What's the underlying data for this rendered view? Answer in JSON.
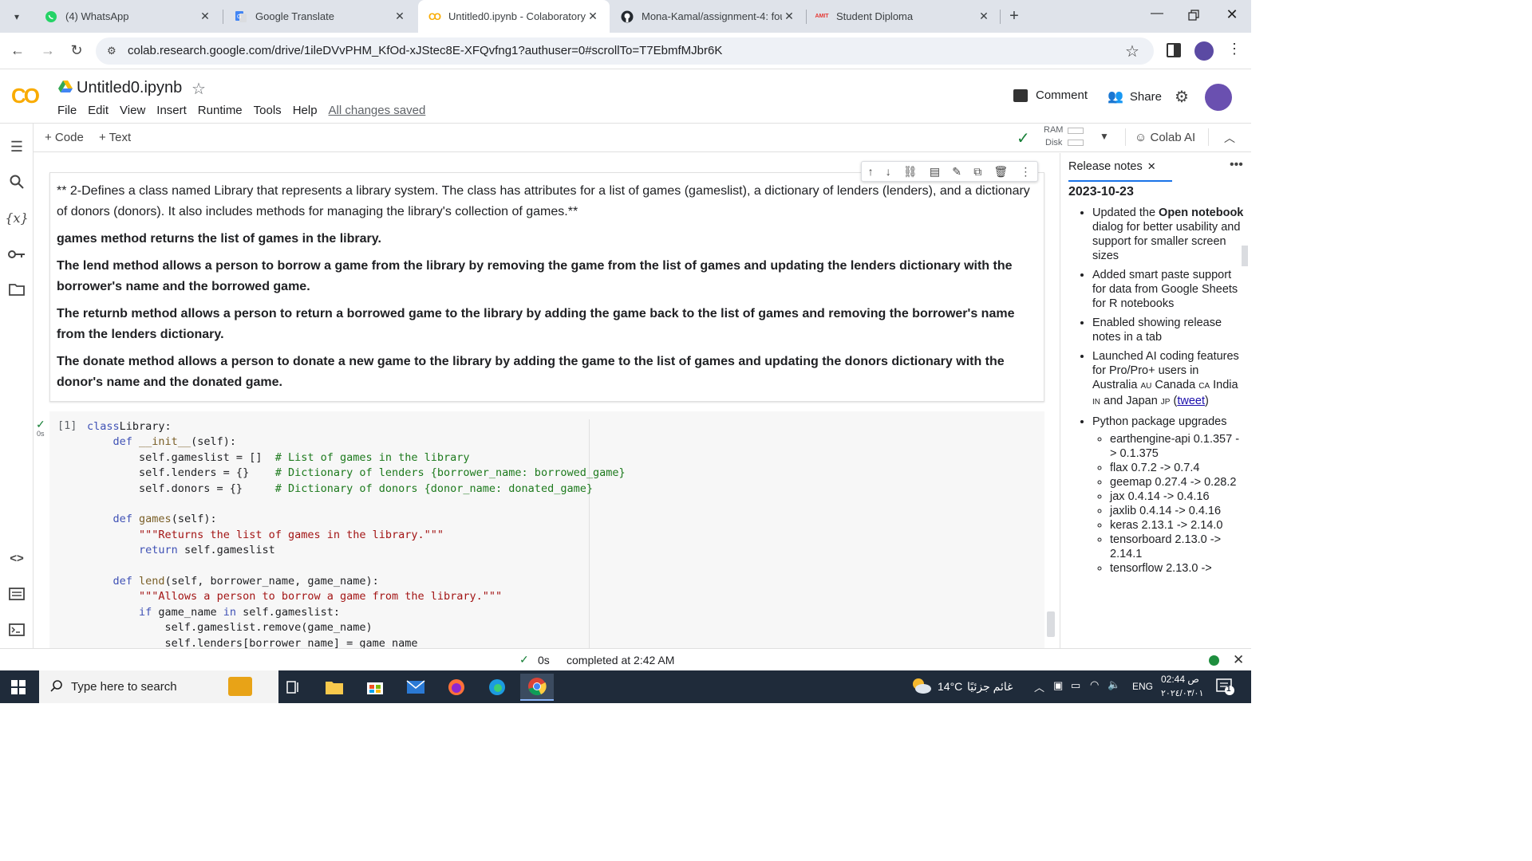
{
  "tabs": [
    {
      "title": "(4) WhatsApp",
      "icon": "whatsapp-icon",
      "color": "#25d366"
    },
    {
      "title": "Google Translate",
      "icon": "translate-icon",
      "color": "#4285f4"
    },
    {
      "title": "Untitled0.ipynb - Colaboratory",
      "icon": "colab-icon",
      "color": "#f9ab00",
      "active": true
    },
    {
      "title": "Mona-Kamal/assignment-4: fou",
      "icon": "github-icon",
      "color": "#24292f"
    },
    {
      "title": "Student Diploma",
      "icon": "amit-icon",
      "color": "#e53935"
    }
  ],
  "browser": {
    "url": "colab.research.google.com/drive/1ileDVvPHM_KfOd-xJStec8E-XFQvfng1?authuser=0#scrollTo=T7EbmfMJbr6K"
  },
  "colab": {
    "logo": "CO",
    "title": "Untitled0.ipynb",
    "menu": [
      "File",
      "Edit",
      "View",
      "Insert",
      "Runtime",
      "Tools",
      "Help"
    ],
    "saved": "All changes saved",
    "comment": "Comment",
    "share": "Share",
    "add_code": "+ Code",
    "add_text": "+ Text",
    "ram": "RAM",
    "disk": "Disk",
    "colab_ai": "Colab AI"
  },
  "text_cell": {
    "intro": "** 2-Defines a class named Library that represents a library system. The class has attributes for a list of games (gameslist), a dictionary of lenders (lenders), and a dictionary of donors (donors). It also includes methods for managing the library's collection of games.**",
    "p1": "games method returns the list of games in the library.",
    "p2": "The lend method allows a person to borrow a game from the library by removing the game from the list of games and updating the lenders dictionary with the borrower's name and the borrowed game.",
    "p3": "The returnb method allows a person to return a borrowed game to the library by adding the game back to the list of games and removing the borrower's name from the lenders dictionary.",
    "p4": "The donate method allows a person to donate a new game to the library by adding the game to the list of games and updating the donors dictionary with the donor's name and the donated game."
  },
  "code_cell": {
    "exec_count": "[1]",
    "exec_time": "0s"
  },
  "release_notes": {
    "tab": "Release notes",
    "date": "2023-10-23",
    "items": [
      "Updated the Open notebook dialog for better usability and support for smaller screen sizes",
      "Added smart paste support for data from Google Sheets for R notebooks",
      "Enabled showing release notes in a tab",
      "Launched AI coding features for Pro/Pro+ users in Australia AU Canada CA India IN and Japan JP (tweet)",
      "Python package upgrades"
    ],
    "sub_items": [
      "earthengine-api 0.1.357 -> 0.1.375",
      "flax 0.7.2 -> 0.7.4",
      "geemap 0.27.4 -> 0.28.2",
      "jax 0.4.14 -> 0.4.16",
      "jaxlib 0.4.14 -> 0.4.16",
      "keras 2.13.1 -> 2.14.0",
      "tensorboard 2.13.0 -> 2.14.1",
      "tensorflow 2.13.0 ->"
    ]
  },
  "status": {
    "time": "0s",
    "completed": "completed at 2:42 AM"
  },
  "taskbar": {
    "search_placeholder": "Type here to search",
    "weather": "14°C",
    "weather_text": "غائم جزئيًا",
    "lang": "ENG",
    "time": "02:44 ص",
    "date": "٢٠٢٤/٠٣/٠١",
    "notif": "1"
  }
}
